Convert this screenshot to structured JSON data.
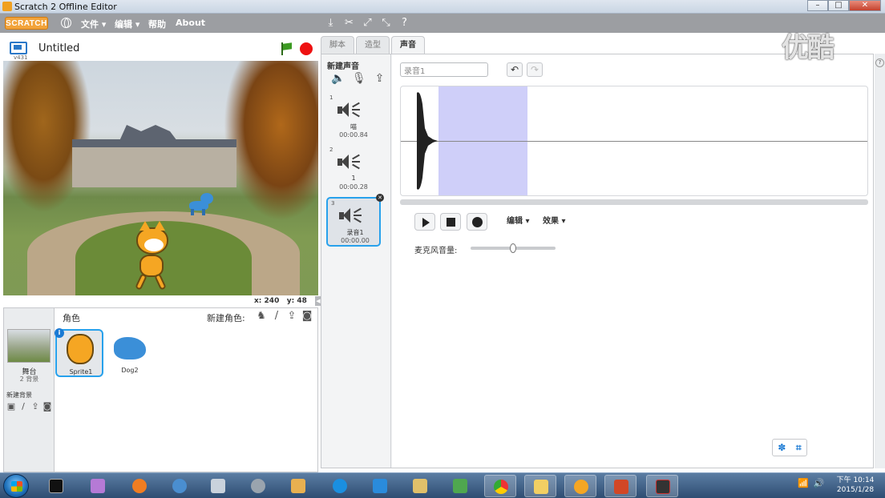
{
  "window": {
    "title": "Scratch 2 Offline Editor",
    "buttons": [
      "–",
      "□",
      "✕"
    ]
  },
  "menu": {
    "logo": "SCRATCH",
    "items": [
      "文件",
      "编辑",
      "帮助",
      "About"
    ],
    "file_label": "文件 ▾",
    "edit_label": "编辑 ▾",
    "help_label": "帮助",
    "about_label": "About"
  },
  "stage": {
    "version": "v431",
    "project_title": "Untitled",
    "coords_x_label": "x:",
    "coords_x": "240",
    "coords_y_label": "y:",
    "coords_y": "48"
  },
  "sprites": {
    "header": "角色",
    "new_sprite": "新建角色:",
    "stage_name": "舞台",
    "stage_backdrops": "2 背景",
    "new_backdrop": "新建背景",
    "list": [
      {
        "name": "Sprite1",
        "selected": true
      },
      {
        "name": "Dog2",
        "selected": false
      }
    ]
  },
  "tabs": [
    {
      "label": "脚本",
      "active": false
    },
    {
      "label": "造型",
      "active": false
    },
    {
      "label": "声音",
      "active": true
    }
  ],
  "sounds": {
    "new_sound": "新建声音",
    "list": [
      {
        "num": "1",
        "name": "喵",
        "duration": "00:00.84"
      },
      {
        "num": "2",
        "name": "1",
        "duration": "00:00.28"
      },
      {
        "num": "3",
        "name": "录音1",
        "duration": "00:00.00",
        "selected": true
      }
    ]
  },
  "editor": {
    "sound_name": "录音1",
    "edit_menu": "编辑 ▾",
    "effects_menu": "效果 ▾",
    "mic_volume_label": "麦克风音量:",
    "mic_volume": 0.5
  },
  "watermark": "优酷",
  "taskbar": {
    "time": "下午 10:14",
    "date": "2015/1/28"
  },
  "colors": {
    "accent": "#27a1ec",
    "menubar": "#9c9ea2",
    "selection": "#cfcff9"
  }
}
